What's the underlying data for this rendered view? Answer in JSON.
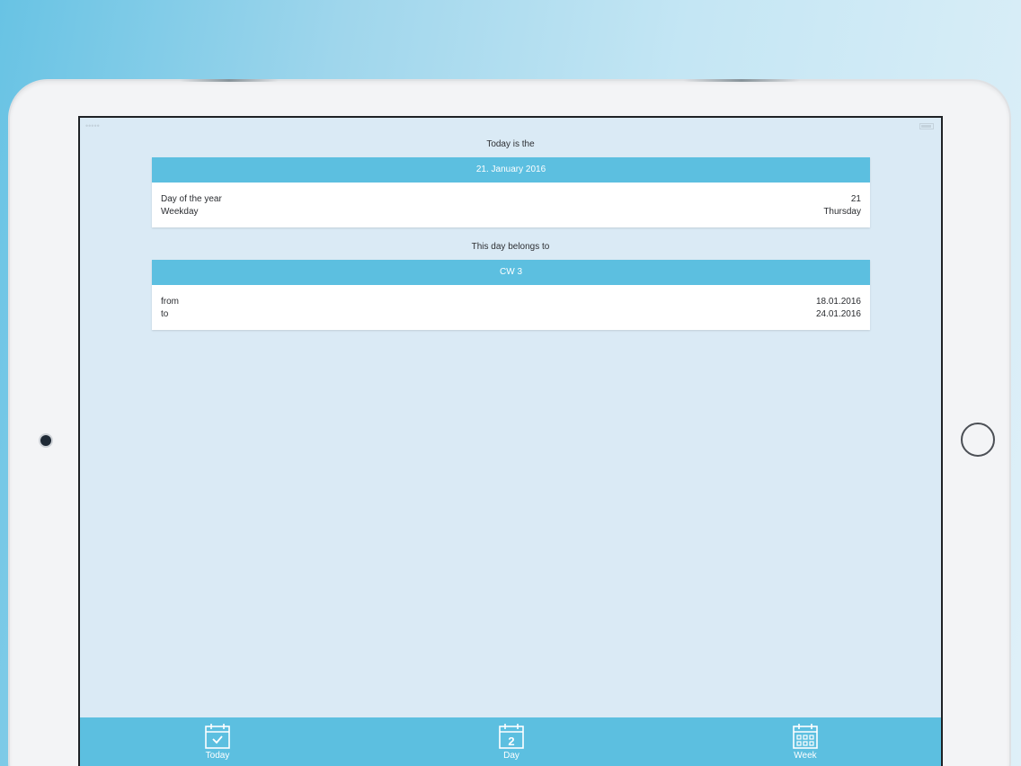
{
  "today_section": {
    "caption": "Today is the",
    "date": "21. January 2016",
    "rows": [
      {
        "label": "Day of the year",
        "value": "21"
      },
      {
        "label": "Weekday",
        "value": "Thursday"
      }
    ]
  },
  "week_section": {
    "caption": "This day belongs to",
    "week": "CW 3",
    "rows": [
      {
        "label": "from",
        "value": "18.01.2016"
      },
      {
        "label": "to",
        "value": "24.01.2016"
      }
    ]
  },
  "tab_bar": {
    "tabs": [
      {
        "label": "Today",
        "icon": "calendar-check-icon"
      },
      {
        "label": "Day",
        "icon": "calendar-day-icon",
        "day_number": "2"
      },
      {
        "label": "Week",
        "icon": "calendar-week-icon"
      }
    ]
  },
  "colors": {
    "accent": "#5cbfe0",
    "screen_background": "#daeaf5",
    "card_background": "#ffffff"
  }
}
